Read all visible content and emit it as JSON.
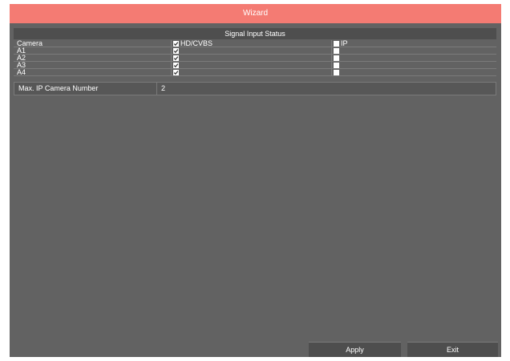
{
  "window": {
    "title": "Wizard"
  },
  "signal_input": {
    "header": "Signal Input Status",
    "columns": [
      "Camera",
      "HD/CVBS",
      "IP"
    ],
    "rows": [
      {
        "camera": "A1",
        "hd_cvbs": true,
        "ip": false
      },
      {
        "camera": "A2",
        "hd_cvbs": true,
        "ip": false
      },
      {
        "camera": "A3",
        "hd_cvbs": true,
        "ip": false
      },
      {
        "camera": "A4",
        "hd_cvbs": true,
        "ip": false
      }
    ],
    "header_checks": {
      "hd_cvbs": true,
      "ip": false
    }
  },
  "max_ip": {
    "label": "Max. IP Camera Number",
    "value": "2"
  },
  "buttons": {
    "apply": "Apply",
    "exit": "Exit"
  },
  "colors": {
    "title_bg": "#f47b73",
    "panel_bg": "#626262"
  }
}
